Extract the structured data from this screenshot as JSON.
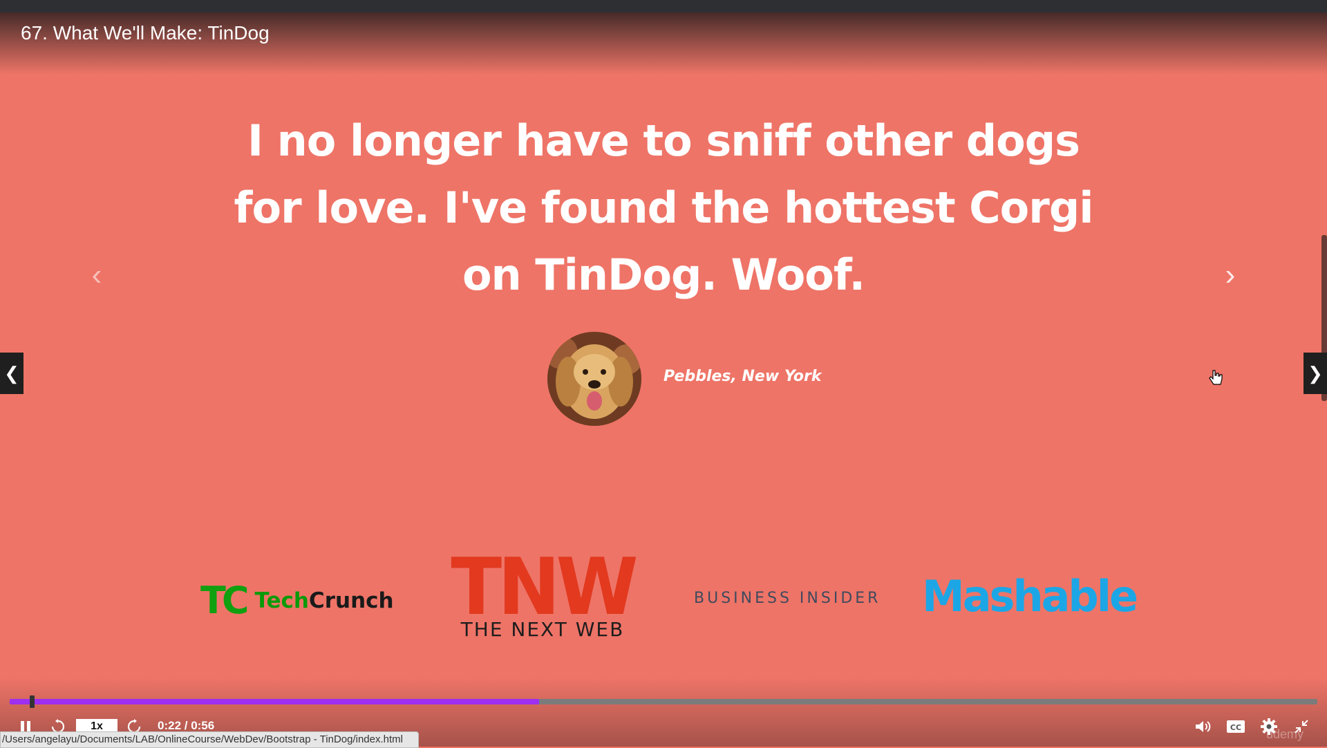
{
  "video": {
    "title": "67. What We'll Make: TinDog"
  },
  "testimonial": {
    "quote": "I no longer have to sniff other dogs for love. I've found the hottest Corgi on TinDog. Woof.",
    "author": "Pebbles, New York",
    "avatar_icon": "golden-retriever-photo"
  },
  "press_logos": {
    "techcrunch_mark": "TC",
    "techcrunch_tech": "Tech",
    "techcrunch_crunch": "Crunch",
    "tnw_mark": "TNW",
    "tnw_sub": "THE NEXT WEB",
    "business_insider": "BUSINESS INSIDER",
    "mashable": "Mashable"
  },
  "player": {
    "speed": "1x",
    "time": "0:22 / 0:56",
    "progress_fraction": 0.405,
    "accent_color": "#9e2ff0"
  },
  "status_bar": {
    "url": "/Users/angelayu/Documents/LAB/OnlineCourse/WebDev/Bootstrap - TinDog/index.html"
  },
  "watermark": "udemy",
  "colors": {
    "background": "#ee7467",
    "techcrunch_green": "#10a010",
    "tnw_red": "#e2391f",
    "mashable_blue": "#1ca6e6"
  }
}
